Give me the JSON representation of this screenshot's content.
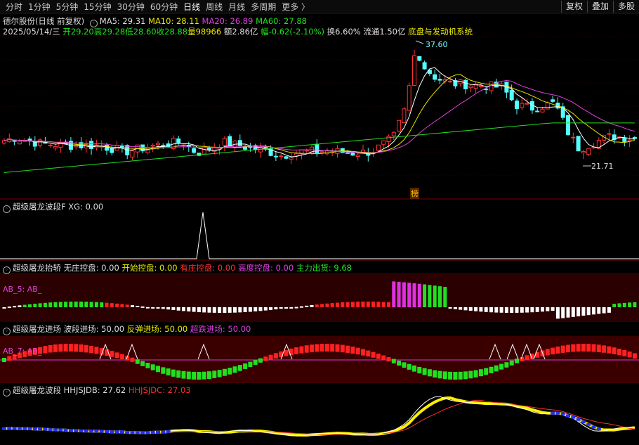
{
  "toolbar": {
    "tabs": [
      "分时",
      "1分钟",
      "5分钟",
      "15分钟",
      "30分钟",
      "60分钟",
      "日线",
      "周线",
      "月线",
      "多周期",
      "更多 〉"
    ],
    "active": "日线",
    "right": [
      "复权",
      "叠加",
      "多股"
    ]
  },
  "main": {
    "stock": "德尔股份(日线 前复权)",
    "ma5": "MA5: 29.31",
    "ma10": "MA10: 28.11",
    "ma20": "MA20: 26.89",
    "ma60": "MA60: 27.88",
    "date": "2025/05/14/三",
    "open": "开29.20",
    "high": "高29.28",
    "low": "低28.60",
    "close": "收28.88",
    "vol": "量98966",
    "amt": "额2.86亿",
    "chg": "幅-0.62(-2.10%)",
    "turnover": "换6.60%",
    "float": "流通1.50亿",
    "concept": "底盘与发动机系统",
    "high_label": "37.60",
    "low_label": "21.71",
    "badge": "榜"
  },
  "panels": {
    "p1": {
      "name": "超级屠龙波段F",
      "xg": "XG: 0.00"
    },
    "p2": {
      "name": "超级屠龙抬轿",
      "a": "无庄控盘: 0.00",
      "b": "开始控盘: 0.00",
      "c": "有庄控盘: 0.00",
      "d": "高度控盘: 0.00",
      "e": "主力出货: 9.68",
      "inner": "AB_5: AB_"
    },
    "p3": {
      "name": "超级屠龙进场",
      "a": "波段进场: 50.00",
      "b": "反弹进场: 50.00",
      "c": "超跌进场: 50.00",
      "inner": "AB_7: AB_"
    },
    "p4": {
      "name": "超级屠龙波段",
      "a": "HHJSJDB: 27.62",
      "b": "HHJSJDC: 27.03"
    }
  },
  "colors": {
    "up": "#ff3232",
    "down": "#54ffff",
    "ma5": "#ffffff",
    "ma10": "#e8e800",
    "ma20": "#e040e0",
    "ma60": "#20e020",
    "bg": "#000000"
  }
}
